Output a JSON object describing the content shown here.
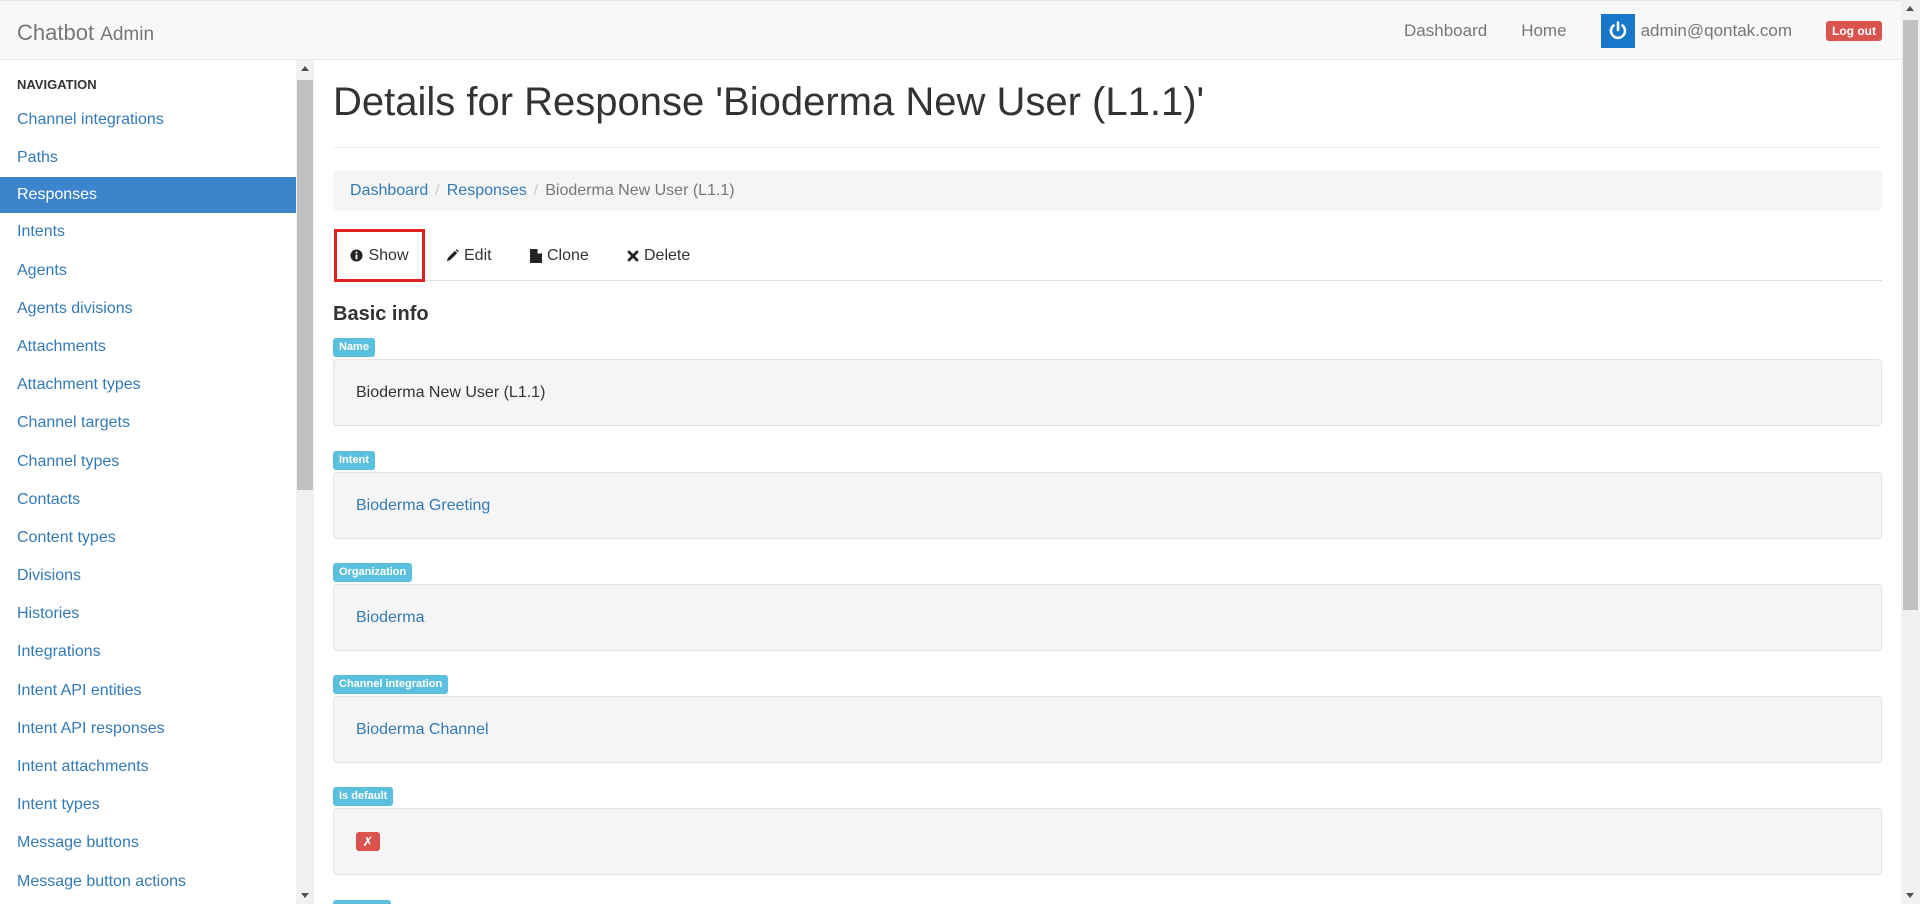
{
  "brand": {
    "name": "Chatbot",
    "sub": "Admin"
  },
  "topnav": {
    "dashboard": "Dashboard",
    "home": "Home",
    "user_email": "admin@qontak.com",
    "logout": "Log out"
  },
  "sidebar": {
    "header": "NAVIGATION",
    "items": [
      {
        "label": "Channel integrations"
      },
      {
        "label": "Paths"
      },
      {
        "label": "Responses",
        "active": true
      },
      {
        "label": "Intents"
      },
      {
        "label": "Agents"
      },
      {
        "label": "Agents divisions"
      },
      {
        "label": "Attachments"
      },
      {
        "label": "Attachment types"
      },
      {
        "label": "Channel targets"
      },
      {
        "label": "Channel types"
      },
      {
        "label": "Contacts"
      },
      {
        "label": "Content types"
      },
      {
        "label": "Divisions"
      },
      {
        "label": "Histories"
      },
      {
        "label": "Integrations"
      },
      {
        "label": "Intent API entities"
      },
      {
        "label": "Intent API responses"
      },
      {
        "label": "Intent attachments"
      },
      {
        "label": "Intent types"
      },
      {
        "label": "Message buttons"
      },
      {
        "label": "Message button actions"
      }
    ]
  },
  "page": {
    "title": "Details for Response 'Bioderma New User (L1.1)'",
    "breadcrumb": {
      "dashboard": "Dashboard",
      "responses": "Responses",
      "current": "Bioderma New User (L1.1)"
    },
    "tabs": {
      "show": "Show",
      "edit": "Edit",
      "clone": "Clone",
      "delete": "Delete"
    },
    "section_title": "Basic info",
    "fields": {
      "name": {
        "label": "Name",
        "value": "Bioderma New User (L1.1)"
      },
      "intent": {
        "label": "Intent",
        "value": "Bioderma Greeting"
      },
      "organization": {
        "label": "Organization",
        "value": "Bioderma"
      },
      "channel_integration": {
        "label": "Channel integration",
        "value": "Bioderma Channel"
      },
      "is_default": {
        "label": "Is default",
        "value": "✗"
      }
    }
  },
  "colors": {
    "link": "#337ab7",
    "active_nav": "#3c85cc",
    "label_info": "#5bc0de",
    "danger": "#d9534f",
    "highlight_border": "#e02020"
  }
}
